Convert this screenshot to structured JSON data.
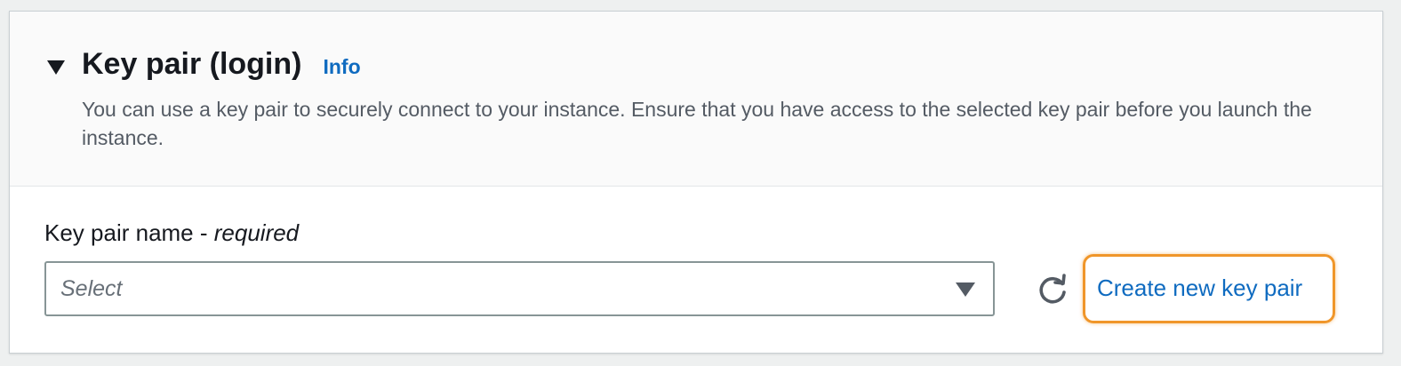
{
  "section": {
    "title": "Key pair (login)",
    "info_label": "Info",
    "description": "You can use a key pair to securely connect to your instance. Ensure that you have access to the selected key pair before you launch the instance."
  },
  "field": {
    "label": "Key pair name - ",
    "required_label": "required",
    "select_placeholder": "Select"
  },
  "actions": {
    "create_label": "Create new key pair"
  },
  "icons": {
    "collapse": "caret-down-icon",
    "dropdown": "caret-down-icon",
    "refresh": "refresh-icon"
  },
  "colors": {
    "link": "#0f6bc0",
    "highlight": "#f0962a",
    "title": "#16191f",
    "muted": "#545b64"
  }
}
